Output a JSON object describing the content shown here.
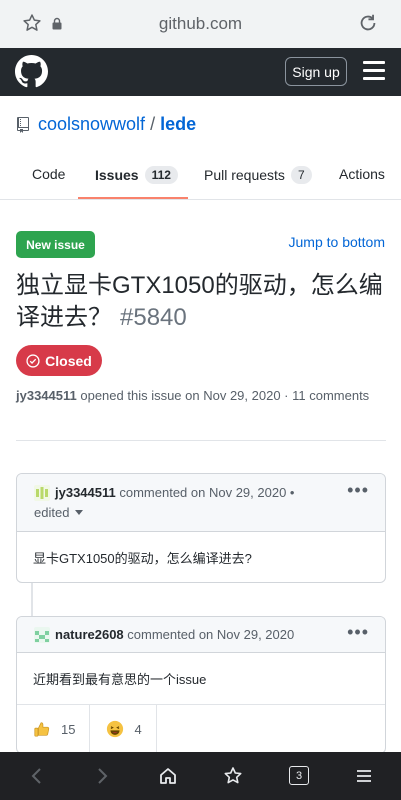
{
  "browser": {
    "url": "github.com",
    "tab_count": "3"
  },
  "header": {
    "signup_label": "Sign up"
  },
  "repo": {
    "owner": "coolsnowwolf",
    "separator": "/",
    "name": "lede"
  },
  "tabs": [
    {
      "label": "Code"
    },
    {
      "label": "Issues",
      "count": "112"
    },
    {
      "label": "Pull requests",
      "count": "7"
    },
    {
      "label": "Actions"
    }
  ],
  "issue": {
    "new_issue_label": "New issue",
    "jump_label": "Jump to bottom",
    "title": "独立显卡GTX1050的驱动，怎么编译进去？",
    "number": "#5840",
    "state_label": "Closed",
    "author": "jy3344511",
    "meta_text": "opened this issue on Nov 29, 2020 · 11 comments"
  },
  "comments": [
    {
      "author": "jy3344511",
      "meta": "commented on Nov 29, 2020 •",
      "edited": "edited",
      "body": "显卡GTX1050的驱动，怎么编译进去?"
    },
    {
      "author": "nature2608",
      "meta": "commented on Nov 29, 2020",
      "body": "近期看到最有意思的一个issue",
      "reactions": [
        {
          "icon": "thumbs-up-icon",
          "count": "15"
        },
        {
          "icon": "laugh-emoji-icon",
          "count": "4"
        }
      ]
    }
  ],
  "colors": {
    "header_bg": "#24292e",
    "link": "#0366d6",
    "closed": "#d73a49",
    "new_issue": "#2ea44f",
    "tab_underline": "#f9826c"
  }
}
